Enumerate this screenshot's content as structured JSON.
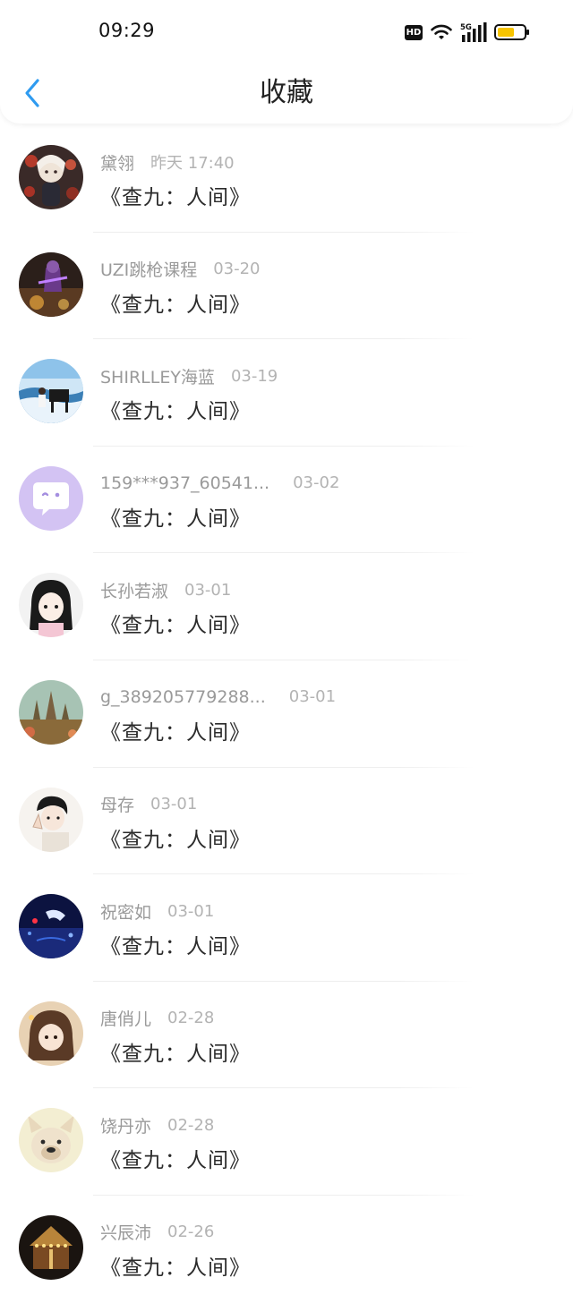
{
  "status_bar": {
    "time": "09:29",
    "hd_label": "HD",
    "network_label": "5G",
    "battery_color": "#f7c400"
  },
  "header": {
    "title": "收藏",
    "back_icon": "chevron-left-icon",
    "accent_color": "#2f9bf0"
  },
  "favorites": [
    {
      "user": "黛翎",
      "time": "昨天 17:40",
      "title": "《查九：人间》",
      "avatar_icon": "avatar-girl-illustration"
    },
    {
      "user": "UZI跳枪课程",
      "time": "03-20",
      "title": "《查九：人间》",
      "avatar_icon": "avatar-game-character"
    },
    {
      "user": "SHIRLLEY海蓝",
      "time": "03-19",
      "title": "《查九：人间》",
      "avatar_icon": "avatar-piano-sea"
    },
    {
      "user": "159***937_60541...",
      "time": "03-02",
      "title": "《查九：人间》",
      "avatar_icon": "avatar-default-chat-bubble"
    },
    {
      "user": "长孙若淑",
      "time": "03-01",
      "title": "《查九：人间》",
      "avatar_icon": "avatar-anime-girl"
    },
    {
      "user": "g_389205779288...",
      "time": "03-01",
      "title": "《查九：人间》",
      "avatar_icon": "avatar-castle-painting"
    },
    {
      "user": "母存",
      "time": "03-01",
      "title": "《查九：人间》",
      "avatar_icon": "avatar-sketch-boy"
    },
    {
      "user": "祝密如",
      "time": "03-01",
      "title": "《查九：人间》",
      "avatar_icon": "avatar-night-scene"
    },
    {
      "user": "唐俏儿",
      "time": "02-28",
      "title": "《查九：人间》",
      "avatar_icon": "avatar-brown-hair-girl"
    },
    {
      "user": "饶丹亦",
      "time": "02-28",
      "title": "《查九：人间》",
      "avatar_icon": "avatar-bulldog"
    },
    {
      "user": "兴辰沛",
      "time": "02-26",
      "title": "《查九：人间》",
      "avatar_icon": "avatar-carousel-lights"
    }
  ]
}
